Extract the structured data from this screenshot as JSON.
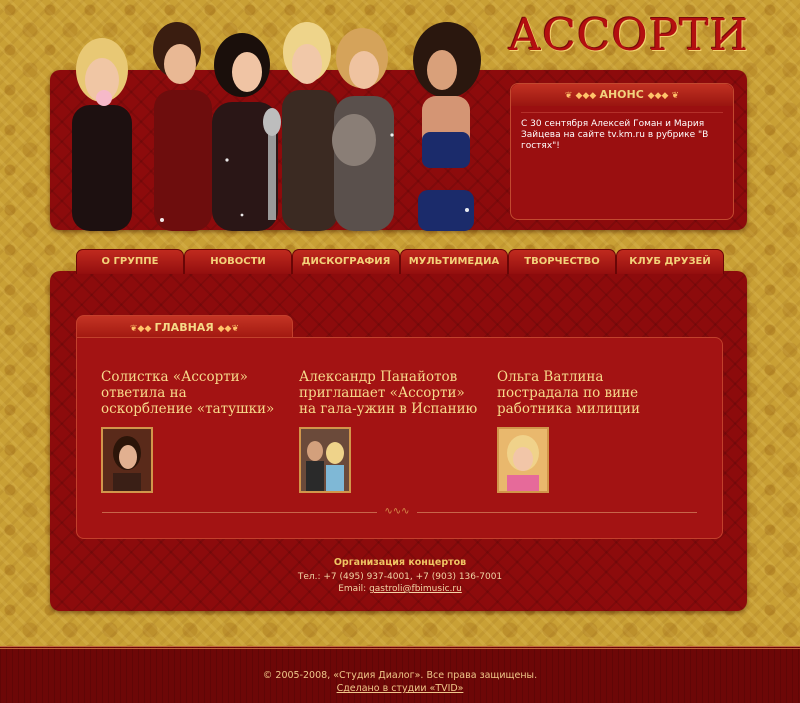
{
  "site": {
    "logo": "АССОРТИ"
  },
  "anons": {
    "title": "АНОНС",
    "text": "С 30 сентября Алексей Гоман и Мария Зайцева на сайте tv.km.ru в рубрике \"В гостях\"!"
  },
  "nav": [
    {
      "label": "О ГРУППЕ"
    },
    {
      "label": "НОВОСТИ"
    },
    {
      "label": "ДИСКОГРАФИЯ"
    },
    {
      "label": "МУЛЬТИМЕДИА"
    },
    {
      "label": "ТВОРЧЕСТВО"
    },
    {
      "label": "КЛУБ ДРУЗЕЙ"
    }
  ],
  "main": {
    "tab_label": "ГЛАВНАЯ",
    "news": [
      {
        "title": "Солистка «Ассорти» ответила на оскорбление «татушки»"
      },
      {
        "title": "Александр Панайотов приглашает «Ассорти» на гала-ужин в Испанию"
      },
      {
        "title": "Ольга Ватлина пострадала по вине работника милиции"
      }
    ]
  },
  "contacts": {
    "title": "Организация концертов",
    "phone": "Тел.: +7 (495) 937-4001, +7 (903) 136-7001",
    "email_prefix": "Email: ",
    "email": "gastroli@fbimusic.ru"
  },
  "footer": {
    "copyright": "© 2005-2008, «Студия Диалог». Все права защищены.",
    "made_by": "Сделано в студии «TVID»"
  },
  "colors": {
    "gold": "#c9a035",
    "wine": "#8d0b0c",
    "accent_text": "#f7da8b",
    "logo_red": "#b30f10"
  }
}
